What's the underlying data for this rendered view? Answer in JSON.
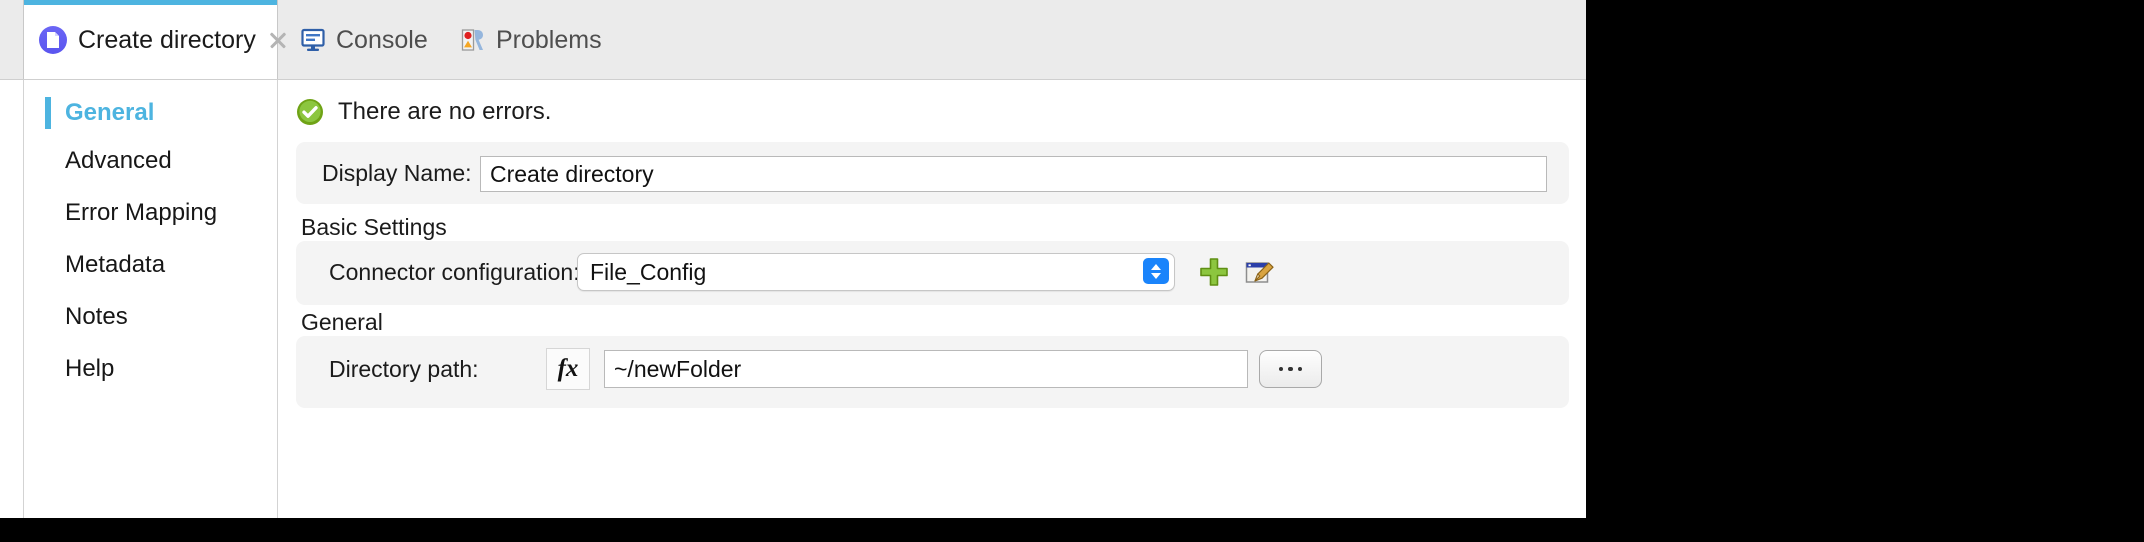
{
  "window": {
    "tabs": [
      {
        "label": "Create directory",
        "icon": "document-icon",
        "active": true,
        "closable": true
      },
      {
        "label": "Console",
        "icon": "console-icon",
        "active": false,
        "closable": false
      },
      {
        "label": "Problems",
        "icon": "problems-icon",
        "active": false,
        "closable": false
      }
    ]
  },
  "sidebar": {
    "items": [
      {
        "label": "General",
        "selected": true
      },
      {
        "label": "Advanced",
        "selected": false
      },
      {
        "label": "Error Mapping",
        "selected": false
      },
      {
        "label": "Metadata",
        "selected": false
      },
      {
        "label": "Notes",
        "selected": false
      },
      {
        "label": "Help",
        "selected": false
      }
    ]
  },
  "main": {
    "status": {
      "icon": "success-check-icon",
      "text": "There are no errors."
    },
    "display_name": {
      "label": "Display Name:",
      "value": "Create directory"
    },
    "basic_settings": {
      "title": "Basic Settings",
      "connector": {
        "label": "Connector configuration:",
        "value": "File_Config",
        "add_icon": "green-plus-icon",
        "edit_icon": "edit-pencil-icon"
      }
    },
    "general": {
      "title": "General",
      "directory_path": {
        "label": "Directory path:",
        "fx_label": "fx",
        "value": "~/newFolder",
        "browse_label": "..."
      }
    }
  },
  "colors": {
    "accent": "#4db4e0",
    "select_blue": "#1a84fb",
    "success_green": "#7ab51d",
    "tab_icon_purple": "#5a55ef"
  }
}
